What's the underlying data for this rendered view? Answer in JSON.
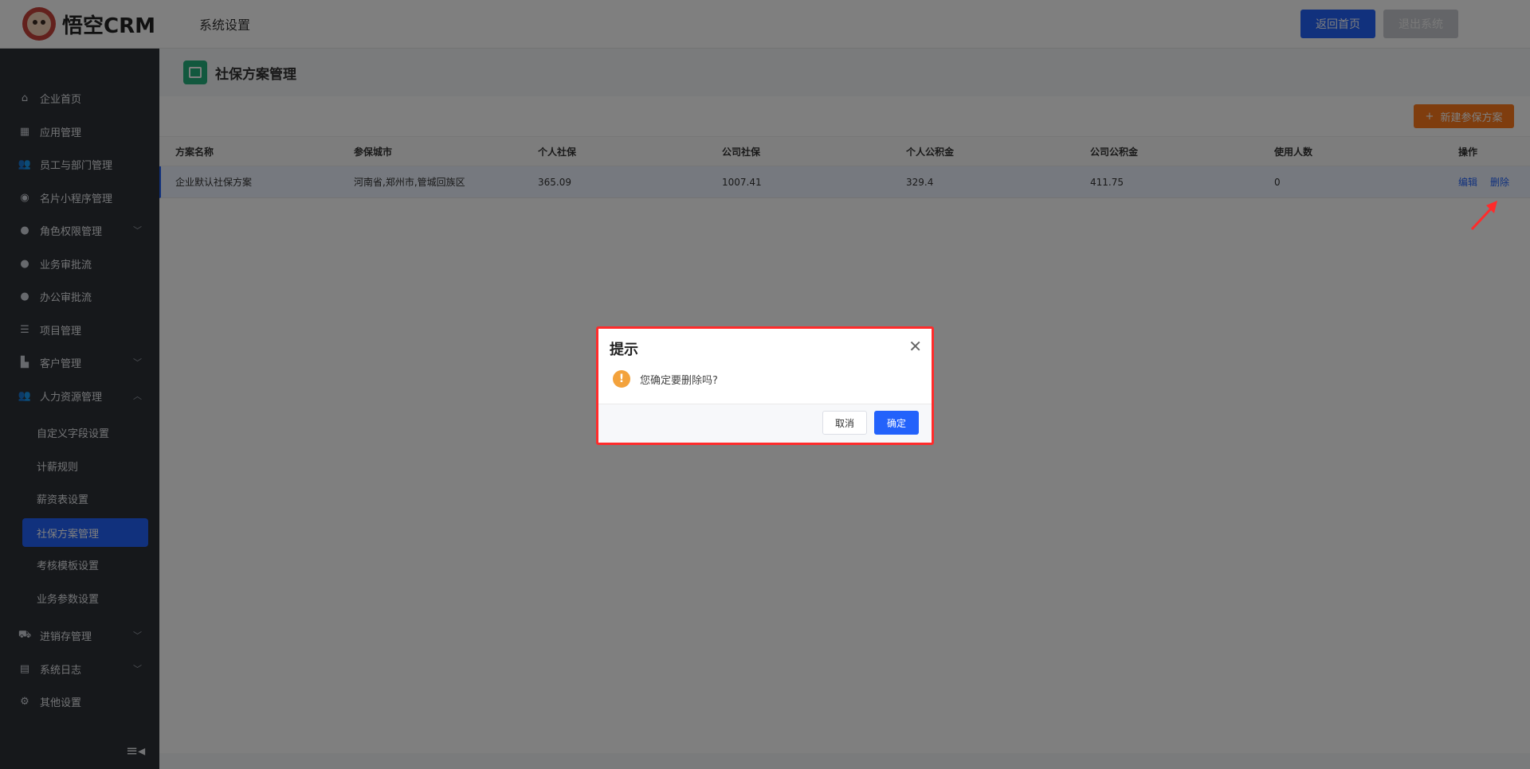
{
  "header": {
    "logo_text": "悟空CRM",
    "title": "系统设置",
    "home_button": "返回首页",
    "logout_button": "退出系统"
  },
  "sidebar": {
    "items": [
      {
        "label": "企业首页",
        "icon": "home-icon"
      },
      {
        "label": "应用管理",
        "icon": "grid-icon"
      },
      {
        "label": "员工与部门管理",
        "icon": "users-icon"
      },
      {
        "label": "名片小程序管理",
        "icon": "compass-icon"
      },
      {
        "label": "角色权限管理",
        "icon": "user-icon"
      },
      {
        "label": "业务审批流",
        "icon": "user-icon"
      },
      {
        "label": "办公审批流",
        "icon": "user-icon"
      },
      {
        "label": "项目管理",
        "icon": "list-icon"
      },
      {
        "label": "客户管理",
        "icon": "building-icon"
      },
      {
        "label": "人力资源管理",
        "icon": "users-icon"
      }
    ],
    "hr_sub_items": [
      "自定义字段设置",
      "计薪规则",
      "薪资表设置",
      "社保方案管理",
      "考核模板设置",
      "业务参数设置"
    ],
    "bottom_items": [
      {
        "label": "进销存管理",
        "icon": "cart-icon"
      },
      {
        "label": "系统日志",
        "icon": "clipboard-icon"
      },
      {
        "label": "其他设置",
        "icon": "gear-icon"
      }
    ]
  },
  "page": {
    "title": "社保方案管理",
    "new_button": "新建参保方案"
  },
  "table": {
    "headers": [
      "方案名称",
      "参保城市",
      "个人社保",
      "公司社保",
      "个人公积金",
      "公司公积金",
      "使用人数",
      "操作"
    ],
    "rows": [
      {
        "name": "企业默认社保方案",
        "city": "河南省,郑州市,管城回族区",
        "personal_social": "365.09",
        "company_social": "1007.41",
        "personal_fund": "329.4",
        "company_fund": "411.75",
        "count": "0",
        "edit": "编辑",
        "delete": "删除"
      }
    ]
  },
  "dialog": {
    "title": "提示",
    "message": "您确定要删除吗?",
    "cancel": "取消",
    "confirm": "确定"
  }
}
